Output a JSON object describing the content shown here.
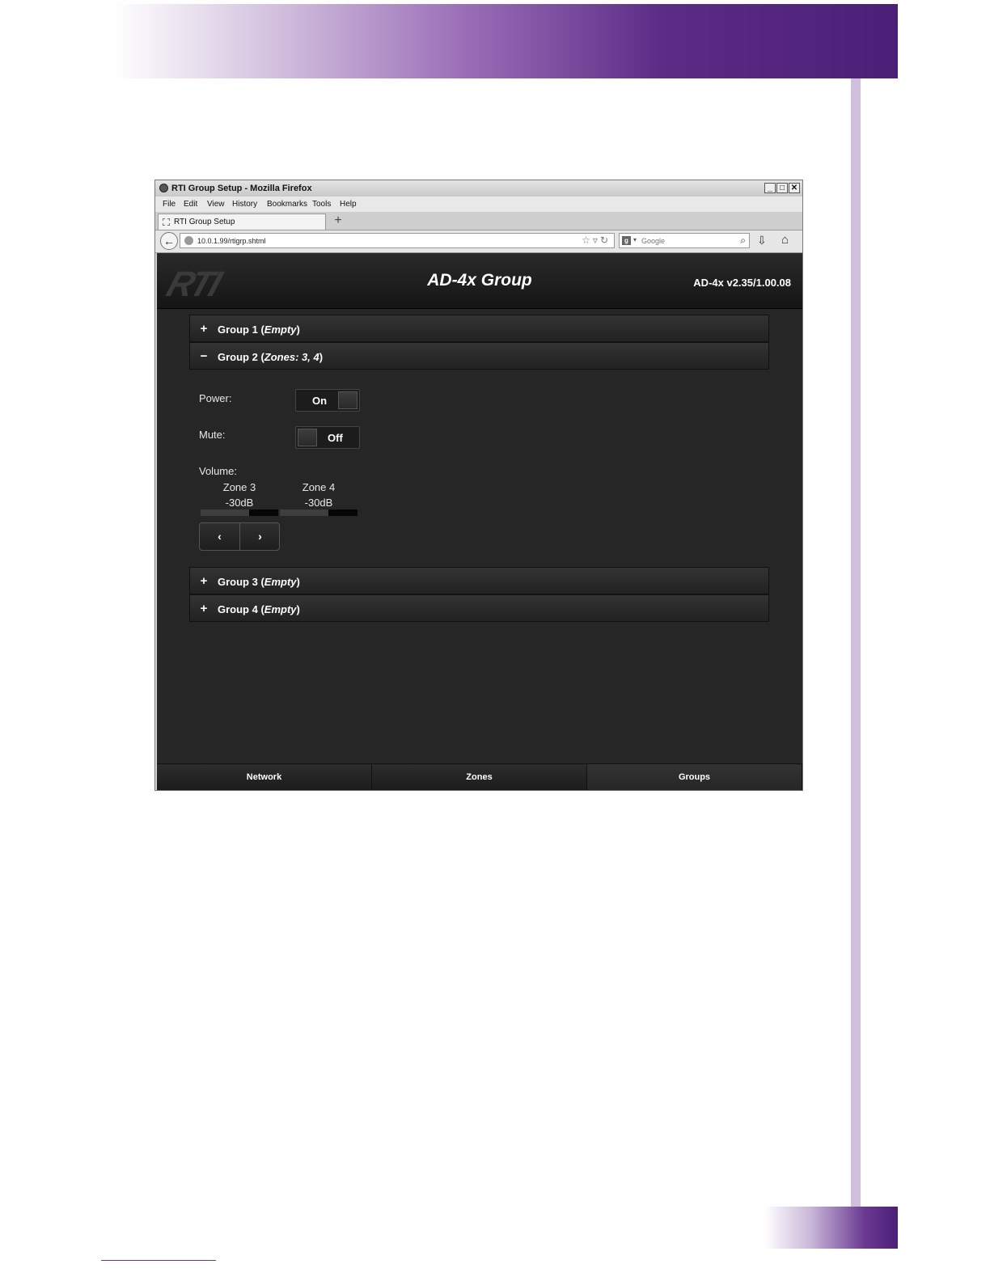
{
  "window": {
    "title": "RTI Group Setup - Mozilla Firefox",
    "controls": [
      "_",
      "□",
      "✕"
    ]
  },
  "menu": [
    "File",
    "Edit",
    "View",
    "History",
    "Bookmarks",
    "Tools",
    "Help"
  ],
  "tab": {
    "label": "RTI Group Setup",
    "new_tab": "+"
  },
  "nav": {
    "url": "10.0.1.99/rtigrp.shtml",
    "search_placeholder": "Google"
  },
  "app": {
    "logo": "RTI",
    "title": "AD-4x Group",
    "version": "AD-4x v2.35/1.00.08"
  },
  "groups": [
    {
      "icon": "+",
      "name": "Group 1",
      "detail": "Empty"
    },
    {
      "icon": "−",
      "name": "Group 2",
      "detail": "Zones: 3, 4"
    },
    {
      "icon": "+",
      "name": "Group 3",
      "detail": "Empty"
    },
    {
      "icon": "+",
      "name": "Group 4",
      "detail": "Empty"
    }
  ],
  "panel": {
    "power_label": "Power:",
    "power_value": "On",
    "mute_label": "Mute:",
    "mute_value": "Off",
    "volume_label": "Volume:",
    "zones": [
      {
        "name": "Zone 3",
        "value": "-30dB",
        "level": 0.62
      },
      {
        "name": "Zone 4",
        "value": "-30dB",
        "level": 0.62
      }
    ],
    "prev": "‹",
    "next": "›"
  },
  "footer": [
    "Network",
    "Zones",
    "Groups"
  ],
  "colors": {
    "accent_purple": "#4b1f78",
    "side_bar": "#cfc0dd",
    "app_bg": "#262626"
  }
}
